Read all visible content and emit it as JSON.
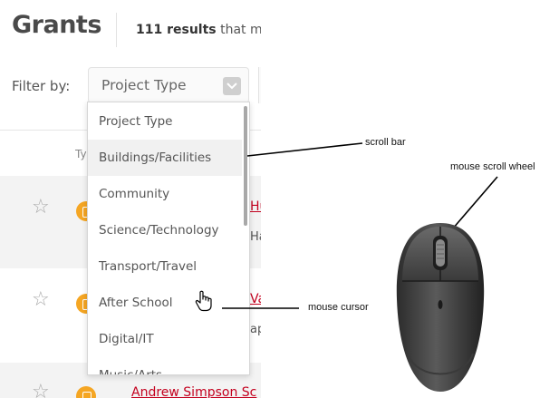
{
  "header": {
    "title": "Grants",
    "results_count": "111 results",
    "results_suffix": "that mat"
  },
  "filter": {
    "label": "Filter by:",
    "selected": "Project Type"
  },
  "table": {
    "column_label": "Ty"
  },
  "dropdown": {
    "options": [
      "Project Type",
      "Buildings/Facilities",
      "Community",
      "Science/Technology",
      "Transport/Travel",
      "After School",
      "Digital/IT",
      "Music/Arts"
    ],
    "highlighted_index": 1
  },
  "rows": [
    {
      "link": "Hunt",
      "sub": "Hawa"
    },
    {
      "link": "Vala",
      "sub": "ape"
    },
    {
      "link": "Andrew Simpson Sc",
      "sub": ""
    }
  ],
  "annotations": {
    "scroll_bar": "scroll bar",
    "mouse_scroll_wheel": "mouse scroll wheel",
    "mouse_cursor": "mouse cursor"
  },
  "colors": {
    "link": "#c4001e",
    "badge": "#f5a623",
    "title": "#4a4a4a"
  },
  "icons": [
    "star-icon",
    "grant-type-icon",
    "chevron-down-icon",
    "hand-cursor-icon",
    "computer-mouse-icon"
  ]
}
